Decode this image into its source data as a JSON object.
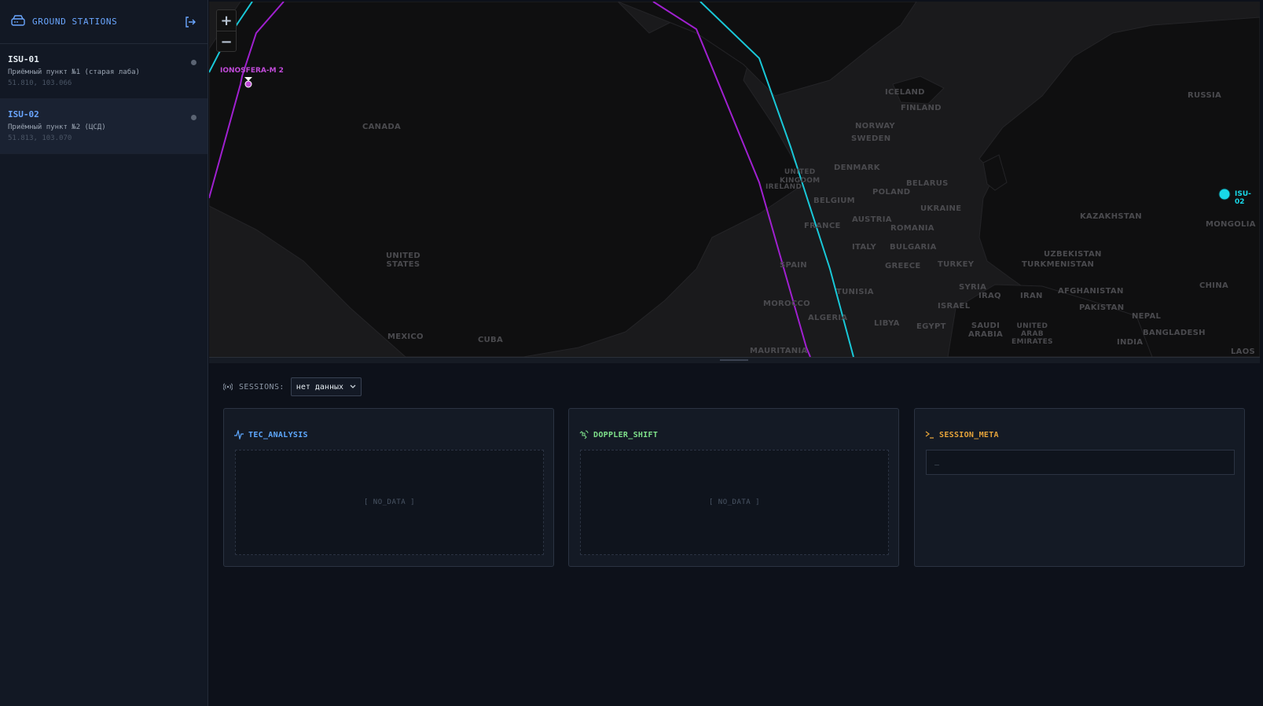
{
  "sidebar": {
    "title": "GROUND STATIONS",
    "stations": [
      {
        "name": "ISU-01",
        "description": "Приёмный пункт №1 (старая лаба)",
        "coords": "51.810, 103.066",
        "active": false
      },
      {
        "name": "ISU-02",
        "description": "Приёмный пункт №2 (ЦСД)",
        "coords": "51.813, 103.070",
        "active": true
      }
    ]
  },
  "map": {
    "zoom_in": "+",
    "zoom_out": "−",
    "satellite_label": "IONOSFERA-M 2",
    "station_marker_label": "ISU-02",
    "countries": {
      "russia": "RUSSIA",
      "finland": "FINLAND",
      "iceland": "ICELAND",
      "norway": "NORWAY",
      "sweden": "SWEDEN",
      "canada": "CANADA",
      "denmark": "DENMARK",
      "united_kingdom": "UNITED\nKINGDOM",
      "ireland": "IRELAND",
      "belarus": "BELARUS",
      "poland": "POLAND",
      "belgium": "BELGIUM",
      "ukraine": "UKRAINE",
      "kazakhstan": "KAZAKHSTAN",
      "mongolia": "MONGOLIA",
      "austria": "AUSTRIA",
      "france": "FRANCE",
      "romania": "ROMANIA",
      "united_states": "UNITED\nSTATES",
      "italy": "ITALY",
      "bulgaria": "BULGARIA",
      "uzbekistan": "UZBEKISTAN",
      "spain": "SPAIN",
      "greece": "GREECE",
      "turkey": "TURKEY",
      "turkmenistan": "TURKMENISTAN",
      "china": "CHINA",
      "tunisia": "TUNISIA",
      "syria": "SYRIA",
      "iraq": "IRAQ",
      "iran": "IRAN",
      "afghanistan": "AFGHANISTAN",
      "morocco": "MOROCCO",
      "israel": "ISRAEL",
      "pakistan": "PAKISTAN",
      "algeria": "ALGERIA",
      "libya": "LIBYA",
      "egypt": "EGYPT",
      "saudi_arabia": "SAUDI\nARABIA",
      "nepal": "NEPAL",
      "mexico": "MEXICO",
      "united_arab_emirates": "UNITED\nARAB\nEMIRATES",
      "bangladesh": "BANGLADESH",
      "cuba": "CUBA",
      "india": "INDIA",
      "mauritania": "MAURITANIA",
      "laos": "LAOS"
    },
    "colors": {
      "track_magenta": "#a020d0",
      "track_cyan": "#19c8d8",
      "station": "#19d8e8"
    }
  },
  "sessions": {
    "label": "SESSIONS:",
    "selected": "нет данных"
  },
  "panels": {
    "tec": {
      "title": "TEC_ANALYSIS",
      "placeholder": "[ NO_DATA ]",
      "color": "#5ea8ff"
    },
    "doppler": {
      "title": "DOPPLER_SHIFT",
      "placeholder": "[ NO_DATA ]",
      "color": "#7ee08a"
    },
    "meta": {
      "title": "SESSION_META",
      "value": "_",
      "color": "#e5a33a"
    }
  }
}
